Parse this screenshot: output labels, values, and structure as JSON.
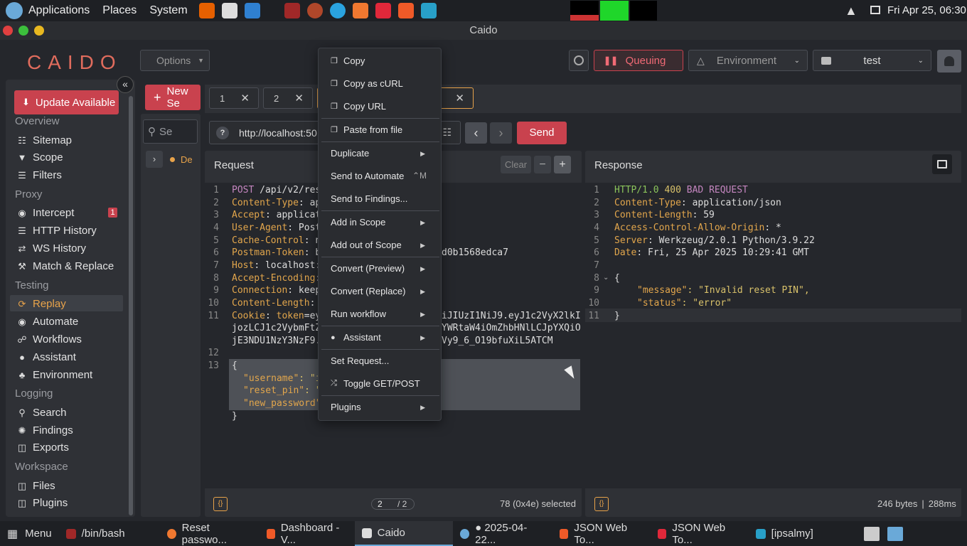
{
  "os": {
    "menu1": "Applications",
    "menu2": "Places",
    "menu3": "System",
    "clock": "Fri Apr 25, 06:30"
  },
  "window_title": "Caido",
  "header": {
    "logo": "CAIDO",
    "options": "Options",
    "queuing": "Queuing",
    "environment": "Environment",
    "project": "test"
  },
  "sidebar": {
    "update": "Update Available",
    "sections": {
      "overview": "Overview",
      "proxy": "Proxy",
      "testing": "Testing",
      "logging": "Logging",
      "workspace": "Workspace"
    },
    "items": {
      "sitemap": "Sitemap",
      "scope": "Scope",
      "filters": "Filters",
      "intercept": "Intercept",
      "intercept_badge": "1",
      "http_history": "HTTP History",
      "ws_history": "WS History",
      "match_replace": "Match & Replace",
      "replay": "Replay",
      "automate": "Automate",
      "workflows": "Workflows",
      "assistant": "Assistant",
      "environment": "Environment",
      "search": "Search",
      "findings": "Findings",
      "exports": "Exports",
      "files": "Files",
      "plugins": "Plugins"
    }
  },
  "replay": {
    "new_session": "New Se",
    "search_placeholder": "Se",
    "tree_item": "De",
    "tabs": [
      "1",
      "2"
    ],
    "url": "http://localhost:50",
    "send": "Send"
  },
  "request": {
    "title": "Request",
    "clear": "Clear",
    "selection_page": "2",
    "selection_total": "/ 2",
    "selected": "78 (0x4e) selected",
    "lines": [
      "1",
      "2",
      "3",
      "4",
      "5",
      "6",
      "7",
      "8",
      "9",
      "10",
      "11",
      "",
      "",
      "12",
      "13",
      "",
      "",
      ""
    ],
    "code": {
      "l1m": "POST",
      "l1p": " /api/v2/res",
      "l2k": "Content-Type",
      "l2v": ": ap",
      "l3k": "Accept",
      "l3v": ": applicat",
      "l4k": "User-Agent",
      "l4v": ": Post",
      "l5k": "Cache-Control",
      "l5v": ": n",
      "l6k": "Postman-Token",
      "l6v": ": b",
      "l6r": "d0b1568edca7",
      "l7k": "Host",
      "l7v": ": localhost:",
      "l8k": "Accept-Encoding",
      "l8v": ":",
      "l9k": "Connection",
      "l9v": ": keep",
      "l10k": "Content-Length",
      "l10v": ":",
      "l11k": "Cookie",
      "l11t": "token",
      "l11v": "=ey",
      "l11r": "iJIUzI1NiJ9.eyJ1c2VyX2lkI",
      "l11b": "jozLCJ1c2VybmFtZ",
      "l11br": "YWRtaW4iOmZhbHNlLCJpYXQiO",
      "l11c": "jE3NDU1NzY3NzF9.",
      "l11cr": "Vy9_6_O19bfuXiL5ATCM",
      "l13a": "{",
      "l13b": "\"username\"",
      "l13bv": ": \"i",
      "l13c": "\"reset_pin\"",
      "l13cv": ": \"",
      "l13d": "\"new_password\"",
      "l13e": "}"
    }
  },
  "response": {
    "title": "Response",
    "size": "246 bytes",
    "time": "288ms",
    "lines": [
      "1",
      "2",
      "3",
      "4",
      "5",
      "6",
      "7",
      "8",
      "9",
      "10",
      "11"
    ],
    "code": {
      "r1a": "HTTP/1.0",
      "r1b": " 400 ",
      "r1c": "BAD REQUEST",
      "r2k": "Content-Type",
      "r2v": ": application/json",
      "r3k": "Content-Length",
      "r3v": ": 59",
      "r4k": "Access-Control-Allow-Origin",
      "r4v": ": *",
      "r5k": "Server",
      "r5v": ": Werkzeug/2.0.1 Python/3.9.22",
      "r6k": "Date",
      "r6v": ": Fri, 25 Apr 2025 10:29:41 GMT",
      "r8": "{",
      "r9k": "\"message\"",
      "r9v": ": \"Invalid reset PIN\",",
      "r10k": "\"status\"",
      "r10v": ": \"error\"",
      "r11": "}"
    }
  },
  "context_menu": {
    "copy": "Copy",
    "copy_curl": "Copy as cURL",
    "copy_url": "Copy URL",
    "paste": "Paste from file",
    "duplicate": "Duplicate",
    "send_automate": "Send to Automate",
    "send_automate_key": "⌃M",
    "send_findings": "Send to Findings...",
    "add_scope": "Add in Scope",
    "add_out_scope": "Add out of Scope",
    "convert_preview": "Convert (Preview)",
    "convert_replace": "Convert (Replace)",
    "run_workflow": "Run workflow",
    "assistant": "Assistant",
    "set_request": "Set Request...",
    "toggle": "Toggle GET/POST",
    "plugins": "Plugins"
  },
  "taskbar": {
    "menu": "Menu",
    "t1": "/bin/bash",
    "t2": "Reset passwo...",
    "t3": "Dashboard - V...",
    "t4": "Caido",
    "t5": "● 2025-04-22...",
    "t6": "JSON Web To...",
    "t7": "JSON Web To...",
    "t8": "[ipsalmy]"
  }
}
